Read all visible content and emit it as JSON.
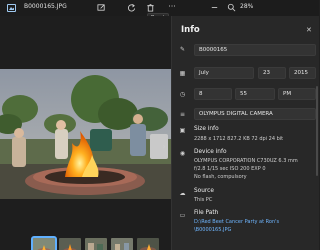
{
  "titlebar": {
    "file_name": "B0000165.JPG",
    "zoom_level": "28%",
    "tooltip": "Reset"
  },
  "info_panel": {
    "title": "Info",
    "title_field": "B0000165",
    "date": {
      "month": "July",
      "day": "23",
      "year": "2015"
    },
    "time": {
      "hour": "8",
      "minute": "55",
      "ampm": "PM"
    },
    "camera_field": "OLYMPUS DIGITAL CAMERA",
    "size": {
      "label": "Size info",
      "details": "2288 x 1712   827.2 KB   72 dpi   24 bit"
    },
    "device": {
      "label": "Device info",
      "line1": "OLYMPUS CORPORATION    C730UZ    6.3 mm",
      "line2": "f/2.8    1/15 sec    ISO 200    EXP 0",
      "line3": "No flash, compulsory"
    },
    "source": {
      "label": "Source",
      "value": "This PC"
    },
    "file_path": {
      "label": "File Path",
      "line1": "D:\\Red Beet Cancer Party at Ron's",
      "line2": "\\B0000165.JPG"
    }
  },
  "icons": {
    "app": "photos-app-icon",
    "edit": "edit-icon",
    "rotate": "rotate-icon",
    "delete": "trash-icon",
    "more": "more-icon",
    "zoom_out": "zoom-out-icon",
    "zoom_in": "zoom-in-icon"
  },
  "colors": {
    "accent": "#60b0ff",
    "panel_bg": "#282828",
    "field_bg": "#333333"
  }
}
